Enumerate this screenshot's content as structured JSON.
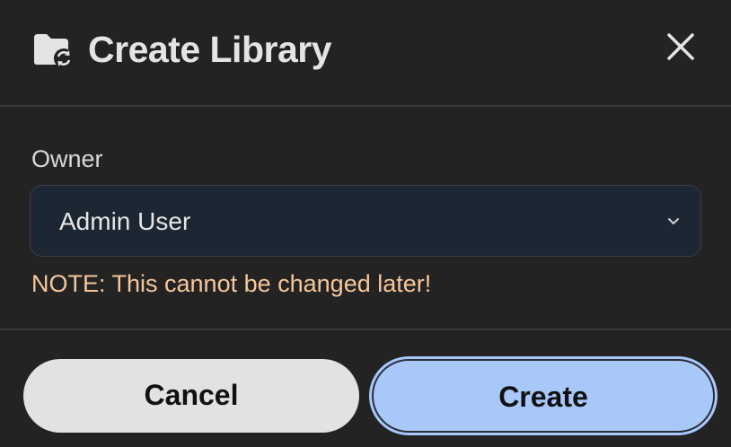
{
  "dialog": {
    "title": "Create Library",
    "title_icon": "folder-sync-icon",
    "close_icon": "close-icon"
  },
  "owner": {
    "label": "Owner",
    "selected_value": "Admin User",
    "chevron_icon": "chevron-down-icon"
  },
  "note": "NOTE: This cannot be changed later!",
  "actions": {
    "cancel_label": "Cancel",
    "create_label": "Create"
  },
  "colors": {
    "background": "#232323",
    "note_text": "#f6c79a",
    "primary_button": "#a8c8fa",
    "secondary_button": "#e2e2e2",
    "select_background": "#1d2633"
  }
}
